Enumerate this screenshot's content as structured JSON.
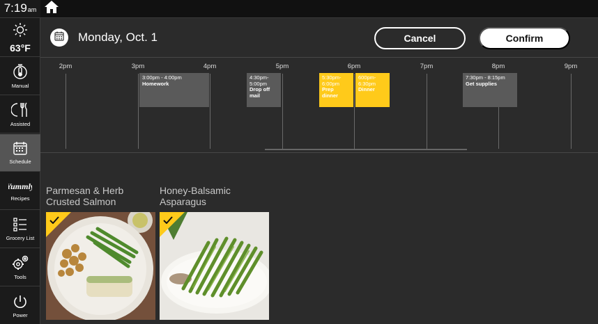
{
  "status": {
    "time": "7:19",
    "ampm": "am",
    "temperature": "63°F"
  },
  "sidebar": {
    "items": [
      {
        "label": "Manual",
        "icon": "thermometer-timer-icon"
      },
      {
        "label": "Assisted",
        "icon": "fork-knife-icon"
      },
      {
        "label": "Schedule",
        "icon": "calendar-icon",
        "active": true
      },
      {
        "label": "Recipes",
        "icon": "yummly-logo-icon"
      },
      {
        "label": "Grocery List",
        "icon": "checklist-icon"
      },
      {
        "label": "Tools",
        "icon": "gears-icon"
      },
      {
        "label": "Power",
        "icon": "power-icon"
      }
    ]
  },
  "header": {
    "date": "Monday, Oct. 1",
    "cancel_label": "Cancel",
    "confirm_label": "Confirm"
  },
  "timeline": {
    "hours": [
      "2pm",
      "3pm",
      "4pm",
      "5pm",
      "6pm",
      "7pm",
      "8pm",
      "9pm"
    ],
    "events": [
      {
        "time": "3:00pm - 4:00pm",
        "title": "Homework",
        "highlight": false
      },
      {
        "time": "4:30pm-5:00pm",
        "title": "Drop off mail",
        "highlight": false
      },
      {
        "time": "5:30pm-6:00pm",
        "title": "Prep dinner",
        "highlight": true
      },
      {
        "time": "600pm-6:30pm",
        "title": "Dinner",
        "highlight": true
      },
      {
        "time": "7:30pm - 8:15pm",
        "title": "Get supplies",
        "highlight": false
      }
    ]
  },
  "recipes": [
    {
      "name_line1": "Parmesan & Herb",
      "name_line2": "Crusted Salmon",
      "selected": true
    },
    {
      "name_line1": "Honey-Balsamic",
      "name_line2": "Asparagus",
      "selected": true
    }
  ],
  "colors": {
    "accent": "#ffca1a",
    "background": "#2b2b2b",
    "sidebar": "#1b1b1b",
    "active_item": "#555555"
  }
}
